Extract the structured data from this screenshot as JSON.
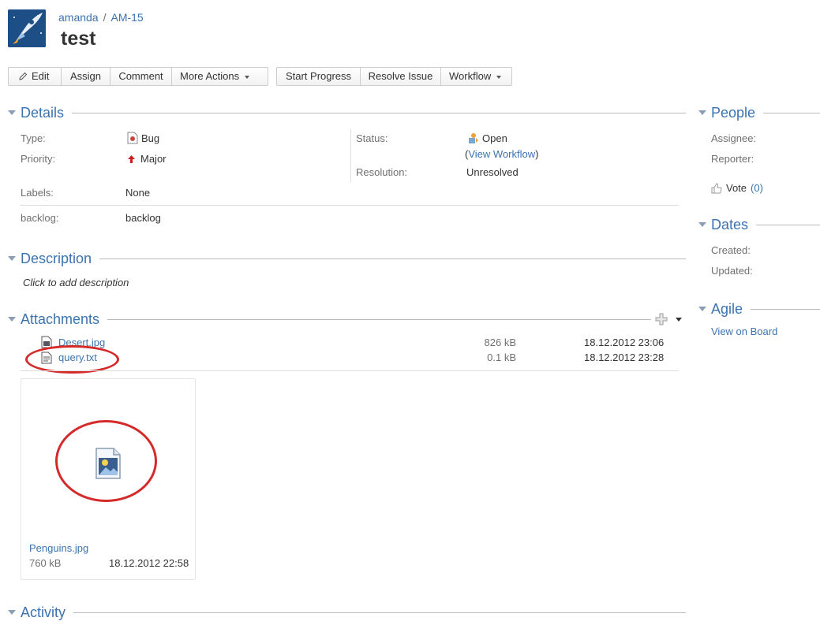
{
  "header": {
    "project": "amanda",
    "separator": "/",
    "issue_key": "AM-15",
    "summary": "test"
  },
  "toolbar": {
    "group1": [
      {
        "id": "edit",
        "label": "Edit",
        "icon": "pencil-icon"
      },
      {
        "id": "assign",
        "label": "Assign"
      },
      {
        "id": "comment",
        "label": "Comment"
      },
      {
        "id": "more-actions",
        "label": "More Actions",
        "dropdown": true
      }
    ],
    "group2": [
      {
        "id": "start-progress",
        "label": "Start Progress"
      },
      {
        "id": "resolve-issue",
        "label": "Resolve Issue"
      },
      {
        "id": "workflow",
        "label": "Workflow",
        "dropdown": true
      }
    ]
  },
  "details": {
    "heading": "Details",
    "type_label": "Type:",
    "type_value": "Bug",
    "priority_label": "Priority:",
    "priority_value": "Major",
    "status_label": "Status:",
    "status_value": "Open",
    "view_workflow_open": "(",
    "view_workflow": "View Workflow",
    "view_workflow_close": ")",
    "resolution_label": "Resolution:",
    "resolution_value": "Unresolved",
    "labels_label": "Labels:",
    "labels_value": "None",
    "backlog_label": "backlog:",
    "backlog_value": "backlog"
  },
  "description": {
    "heading": "Description",
    "placeholder": "Click to add description"
  },
  "attachments": {
    "heading": "Attachments",
    "files": [
      {
        "name": "Desert.jpg",
        "size": "826 kB",
        "date": "18.12.2012 23:06",
        "icon": "image-file-icon"
      },
      {
        "name": "query.txt",
        "size": "0.1 kB",
        "date": "18.12.2012 23:28",
        "icon": "text-file-icon"
      }
    ],
    "thumbnail": {
      "name": "Penguins.jpg",
      "size": "760 kB",
      "date": "18.12.2012 22:58"
    }
  },
  "activity": {
    "heading": "Activity"
  },
  "people": {
    "heading": "People",
    "assignee_label": "Assignee:",
    "reporter_label": "Reporter:",
    "vote_label": "Vote",
    "vote_count": "(0)"
  },
  "dates": {
    "heading": "Dates",
    "created_label": "Created:",
    "updated_label": "Updated:"
  },
  "agile": {
    "heading": "Agile",
    "view_on_board": "View on Board"
  },
  "colors": {
    "link": "#3b73af",
    "heading": "#3b73af",
    "annotation_red": "#d42a2a"
  }
}
